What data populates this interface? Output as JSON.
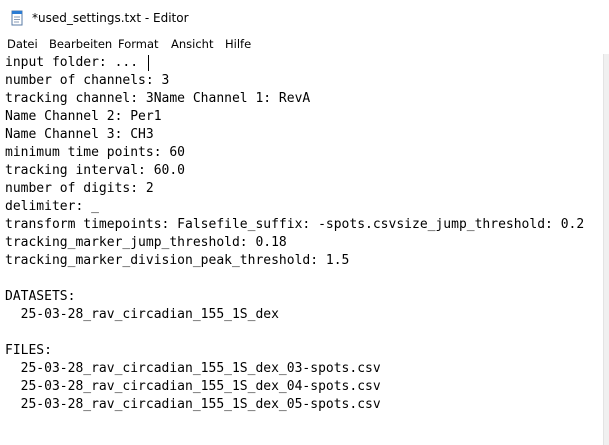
{
  "window": {
    "title": "*used_settings.txt - Editor",
    "icon": "notepad-icon"
  },
  "menu": {
    "items": [
      "Datei",
      "Bearbeiten",
      "Format",
      "Ansicht",
      "Hilfe"
    ]
  },
  "editor": {
    "lines": [
      "input folder: ...",
      "number of channels: 3",
      "tracking channel: 3Name Channel 1: RevA",
      "Name Channel 2: Per1",
      "Name Channel 3: CH3",
      "minimum time points: 60",
      "tracking interval: 60.0",
      "number of digits: 2",
      "delimiter: _",
      "transform timepoints: Falsefile_suffix: -spots.csvsize_jump_threshold: 0.2",
      "tracking_marker_jump_threshold: 0.18",
      "tracking_marker_division_peak_threshold: 1.5",
      "",
      "DATASETS:",
      "  25-03-28_rav_circadian_155_1S_dex",
      "",
      "FILES:",
      "  25-03-28_rav_circadian_155_1S_dex_03-spots.csv",
      "  25-03-28_rav_circadian_155_1S_dex_04-spots.csv",
      "  25-03-28_rav_circadian_155_1S_dex_05-spots.csv"
    ]
  },
  "colors": {
    "background": "#ffffff",
    "text": "#000000",
    "icon_blue": "#2b7cd3"
  }
}
